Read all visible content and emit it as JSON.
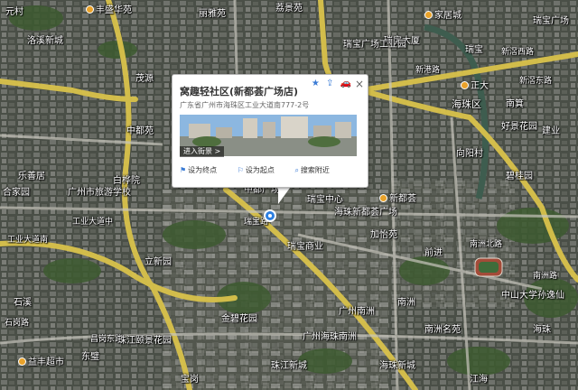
{
  "popup": {
    "title": "窝趣轻社区(新都荟广场店)",
    "address": "广东省广州市海珠区工业大道南777-2号",
    "photo_caption": "进入街景 >",
    "actions": {
      "star": "★",
      "share": "⇪",
      "car": "🚗"
    },
    "close": "×",
    "links": {
      "to_end": "设为终点",
      "to_start": "设为起点",
      "search_nearby": "搜索附近"
    }
  },
  "labels": {
    "l1": "元村",
    "l2": "丰盛华苑",
    "l3": "丽雅苑",
    "l4": "荔景苑",
    "l5": "家居城",
    "l6": "瑞宝广场",
    "l7": "瑞宝大厦",
    "l8": "瑞宝广场工业园",
    "l9": "瑞宝",
    "l10": "新滘西路",
    "l11": "新港路",
    "l12": "洛溪新城",
    "l13": "广州市旅游学校",
    "l14": "白桦院",
    "l15": "海珠区",
    "l16": "茂源",
    "l17": "合家园",
    "l18": "乐善居",
    "l19": "中都广场",
    "l20": "瑞宝中心",
    "l21": "海珠新都荟广场",
    "l22": "工业大道南",
    "l23": "瑞宝商业",
    "l24": "加怡苑",
    "l25": "南洲北路",
    "l26": "前进",
    "l27": "南洲路",
    "l28": "昌岗东路",
    "l29": "南洲",
    "l30": "立新园",
    "l31": "金碧花园",
    "l32": "广州海珠南洲",
    "l33": "石溪",
    "l34": "东璧",
    "l35": "益丰超市",
    "l36": "珠江新城",
    "l37": "宝岗",
    "l38": "中山大学孙逸仙",
    "l39": "南洲名苑",
    "l40": "珠江颐景花园",
    "l41": "新滘东路",
    "l42": "向阳村",
    "l43": "正大",
    "l44": "南箕",
    "l45": "石岗路",
    "l46": "工业大道中",
    "l47": "广州南洲",
    "l48": "新都荟",
    "l49": "碧桂园",
    "l50": "中都苑",
    "l51": "建业",
    "l52": "瑞宝路",
    "l53": "好景花园",
    "l54": "海珠",
    "l55": "海珠新城",
    "l56": "江海"
  }
}
